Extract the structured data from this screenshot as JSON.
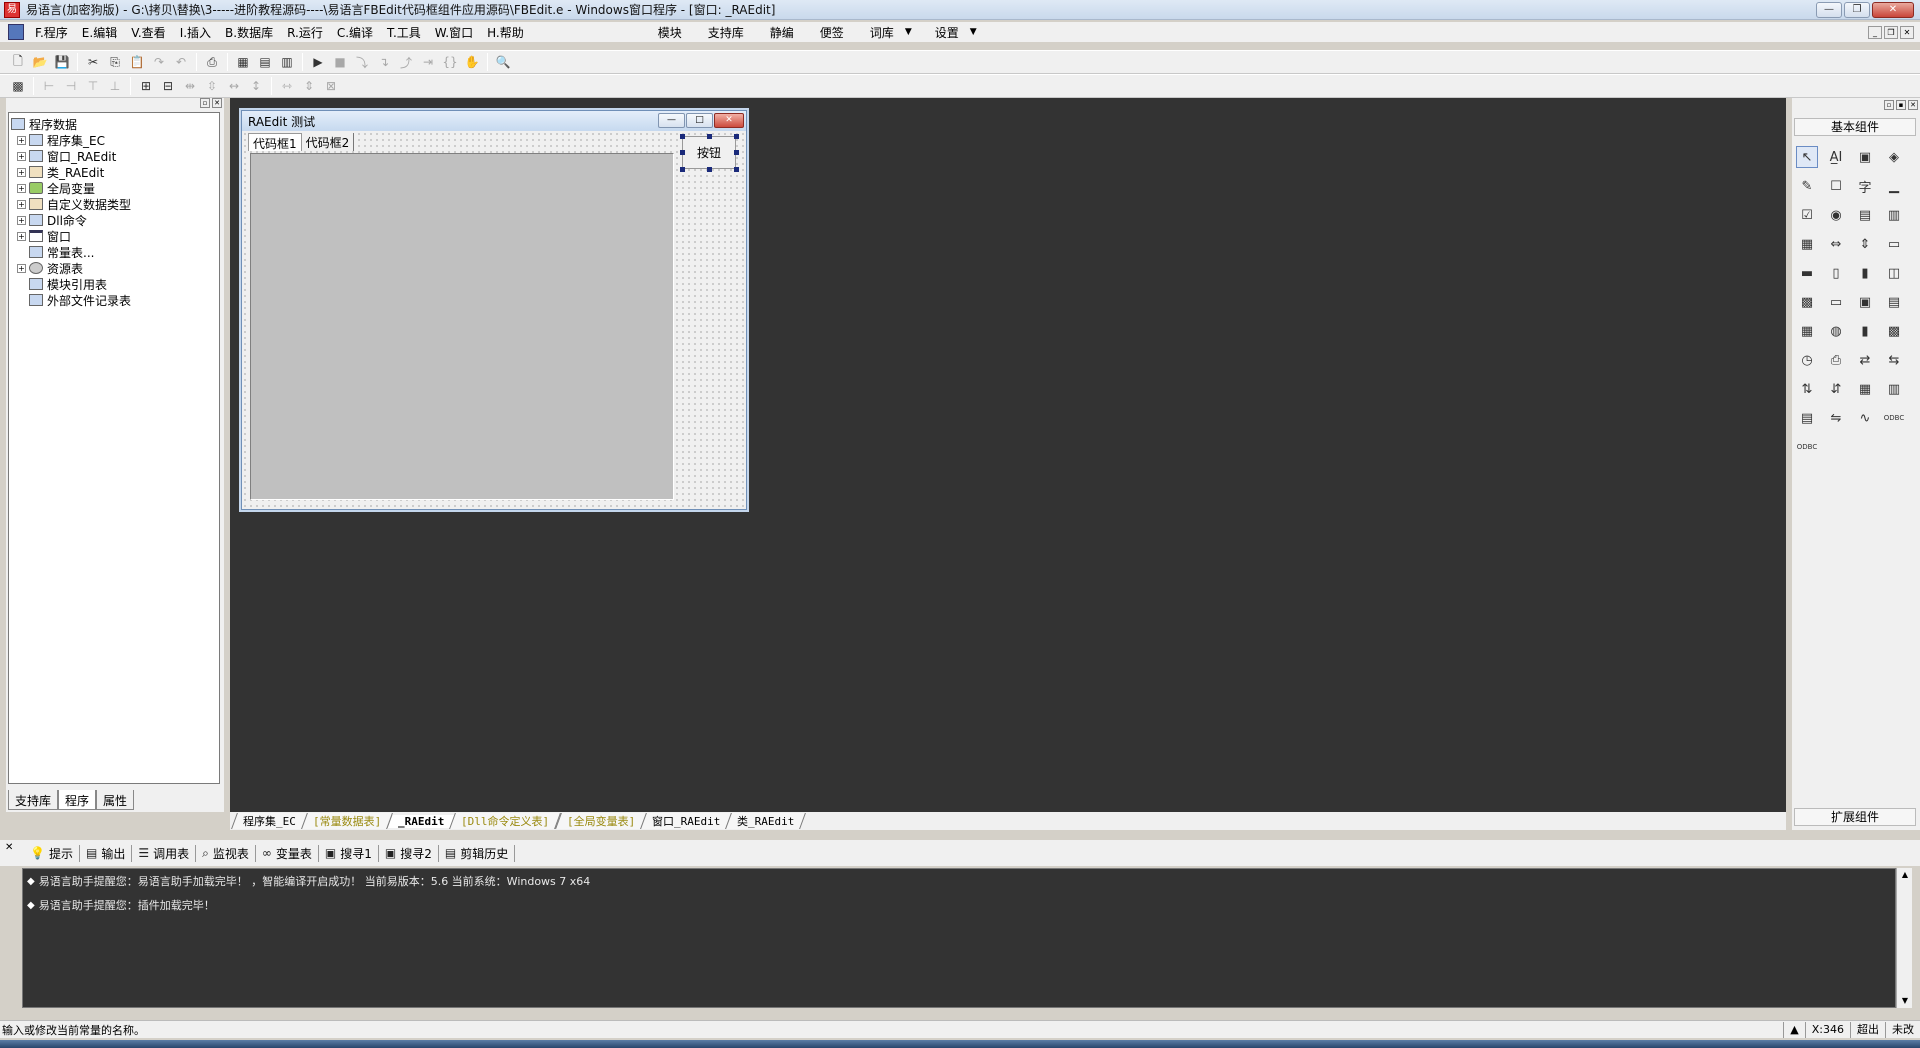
{
  "window": {
    "title": "易语言(加密狗版) - G:\\拷贝\\替换\\3-----进阶教程源码----\\易语言FBEdit代码框组件应用源码\\FBEdit.e - Windows窗口程序 - [窗口: _RAEdit]",
    "minimize": "—",
    "restore": "❐",
    "close": "✕"
  },
  "menu": {
    "items": [
      "F.程序",
      "E.编辑",
      "V.查看",
      "I.插入",
      "B.数据库",
      "R.运行",
      "C.编译",
      "T.工具",
      "W.窗口",
      "H.帮助"
    ],
    "right_items": [
      "模块",
      "支持库",
      "静编",
      "便签",
      "词库",
      "设置"
    ]
  },
  "left_panel": {
    "tree": [
      {
        "label": "程序数据",
        "expander": "",
        "icon": "db"
      },
      {
        "label": "程序集_EC",
        "expander": "+",
        "icon": "db"
      },
      {
        "label": "窗口_RAEdit",
        "expander": "+",
        "icon": "db"
      },
      {
        "label": "类_RAEdit",
        "expander": "+",
        "icon": "cls"
      },
      {
        "label": "全局变量",
        "expander": "+",
        "icon": "glob"
      },
      {
        "label": "自定义数据类型",
        "expander": "+",
        "icon": "cls"
      },
      {
        "label": "Dll命令",
        "expander": "+",
        "icon": "db"
      },
      {
        "label": "窗口",
        "expander": "+",
        "icon": "win"
      },
      {
        "label": "常量表...",
        "expander": "",
        "icon": "db"
      },
      {
        "label": "资源表",
        "expander": "+",
        "icon": "res"
      },
      {
        "label": "模块引用表",
        "expander": "",
        "icon": "db"
      },
      {
        "label": "外部文件记录表",
        "expander": "",
        "icon": "db"
      }
    ],
    "tabs": [
      "支持库",
      "程序",
      "属性"
    ]
  },
  "form": {
    "title": "RAEdit 测试",
    "tabs": [
      "代码框1",
      "代码框2"
    ],
    "button_label": "按钮"
  },
  "file_tabs": [
    {
      "label": "程序集_EC",
      "style": "normal"
    },
    {
      "label": "[常量数据表]",
      "style": "yellow"
    },
    {
      "label": "_RAEdit",
      "style": "active"
    },
    {
      "label": "[Dll命令定义表]",
      "style": "yellow"
    },
    {
      "label": "[全局变量表]",
      "style": "yellow"
    },
    {
      "label": "窗口_RAEdit",
      "style": "normal"
    },
    {
      "label": "类_RAEdit",
      "style": "normal"
    }
  ],
  "palette": {
    "header": "基本组件",
    "footer": "扩展组件",
    "icons": [
      "↖",
      "A̲I",
      "▣",
      "◈",
      "✎",
      "☐",
      "字",
      "▁",
      "☑",
      "◉",
      "▤",
      "▥",
      "▦",
      "⇔",
      "⇕",
      "▭",
      "▬",
      "▯",
      "▮",
      "◫",
      "▩",
      "▭",
      "▣",
      "▤",
      "▦",
      "◍",
      "▮",
      "▩",
      "◷",
      "⎙",
      "⇄",
      "⇆",
      "⇅",
      "⇵",
      "▦",
      "▥",
      "▤",
      "⇋",
      "∿",
      "ODBC",
      "ODBC"
    ]
  },
  "output": {
    "tabs": [
      {
        "icon": "💡",
        "label": "提示"
      },
      {
        "icon": "▤",
        "label": "输出"
      },
      {
        "icon": "☰",
        "label": "调用表"
      },
      {
        "icon": "⌕",
        "label": "监视表"
      },
      {
        "icon": "∞",
        "label": "变量表"
      },
      {
        "icon": "▣",
        "label": "搜寻1"
      },
      {
        "icon": "▣",
        "label": "搜寻2"
      },
      {
        "icon": "▤",
        "label": "剪辑历史"
      }
    ],
    "lines": [
      "易语言助手提醒您：易语言助手加载完毕！ ，智能编译开启成功！ 当前易版本：5.6  当前系统：Windows 7 x64",
      "易语言助手提醒您：插件加载完毕！"
    ]
  },
  "status": {
    "text": "输入或修改当前常量的名称。",
    "coord": "X:346",
    "mode1": "超出",
    "mode2": "未改"
  }
}
